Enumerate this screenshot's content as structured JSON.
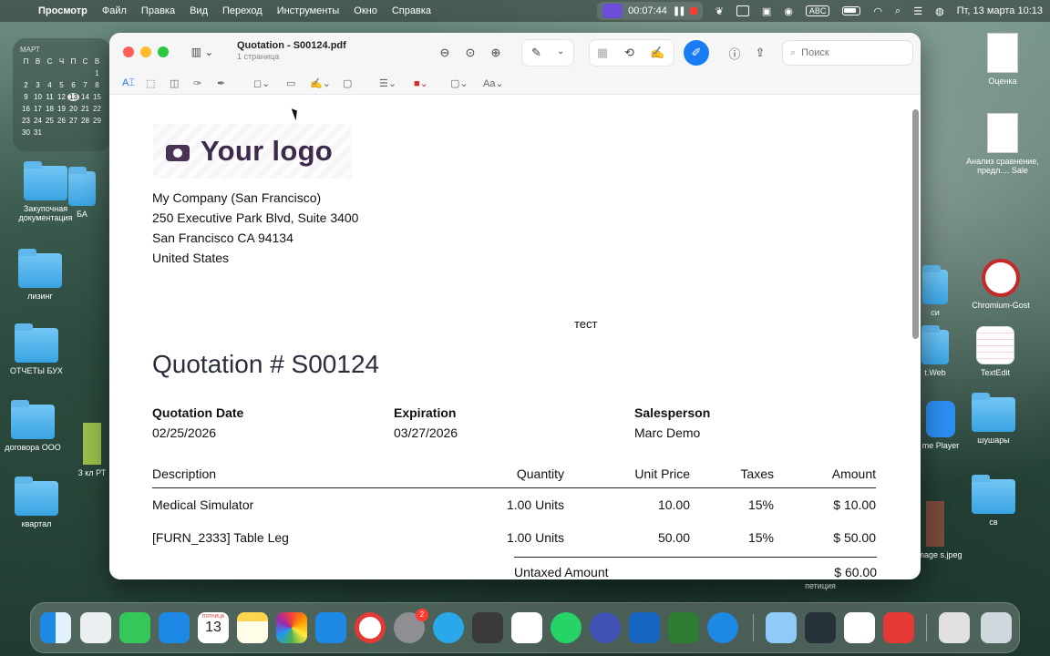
{
  "menubar": {
    "app_name": "Просмотр",
    "items": [
      "Файл",
      "Правка",
      "Вид",
      "Переход",
      "Инструменты",
      "Окно",
      "Справка"
    ],
    "timer": "00:07:44",
    "keyboard": "ABC",
    "datetime": "Пт, 13 марта  10:13"
  },
  "calendar_widget": {
    "month": "МАРТ",
    "weekdays": [
      "П",
      "В",
      "С",
      "Ч",
      "П",
      "С",
      "В"
    ],
    "days": [
      "",
      "",
      "",
      "",
      "",
      "",
      "1",
      "2",
      "3",
      "4",
      "5",
      "6",
      "7",
      "8",
      "9",
      "10",
      "11",
      "12",
      "13",
      "14",
      "15",
      "16",
      "17",
      "18",
      "19",
      "20",
      "21",
      "22",
      "23",
      "24",
      "25",
      "26",
      "27",
      "28",
      "29",
      "30",
      "31"
    ],
    "today": "13"
  },
  "desktop": {
    "left_icons": [
      "Закупочная документация",
      "БА",
      "лизинг",
      "ОТЧЕТЫ БУХ",
      "договора ООО",
      "3 кл РТ",
      "квартал"
    ],
    "right_icons": [
      "Оценка",
      "Анализ сравнение, предл.... Sale",
      "Chromium-Gost",
      "си",
      "TextEdit",
      "t.Web",
      "шушары",
      "me Player",
      "св",
      "n Image s.jpeg",
      "петиция"
    ]
  },
  "window": {
    "title": "Quotation - S00124.pdf",
    "subtitle": "1 страница",
    "search_placeholder": "Поиск"
  },
  "doc": {
    "logo_text": "Your logo",
    "address": [
      "My Company (San Francisco)",
      "250 Executive Park Blvd, Suite 3400",
      "San Francisco CA 94134",
      "United States"
    ],
    "annotation": "тест",
    "title": "Quotation # S00124",
    "meta": [
      {
        "label": "Quotation Date",
        "value": "02/25/2026"
      },
      {
        "label": "Expiration",
        "value": "03/27/2026"
      },
      {
        "label": "Salesperson",
        "value": "Marc Demo"
      }
    ],
    "headers": {
      "description": "Description",
      "quantity": "Quantity",
      "unit_price": "Unit Price",
      "taxes": "Taxes",
      "amount": "Amount"
    },
    "lines": [
      {
        "description": "Medical Simulator",
        "quantity": "1.00 Units",
        "unit_price": "10.00",
        "taxes": "15%",
        "amount": "$ 10.00"
      },
      {
        "description": "[FURN_2333] Table Leg",
        "quantity": "1.00 Units",
        "unit_price": "50.00",
        "taxes": "15%",
        "amount": "$ 50.00"
      }
    ],
    "untaxed_label": "Untaxed Amount",
    "untaxed_value": "$ 60.00"
  },
  "dock": {
    "calendar_month": "ПЯТНИЦА",
    "calendar_day": "13",
    "settings_badge": "2",
    "apps": [
      "finder-icon",
      "launchpad-icon",
      "messages-icon",
      "mail-icon",
      "calendar-icon",
      "notes-icon",
      "photos-icon",
      "app-store-icon",
      "opera-icon",
      "system-settings-icon",
      "telegram-icon",
      "calculator-icon",
      "freeform-icon",
      "whatsapp-icon",
      "yandex-icon",
      "word-icon",
      "excel-icon",
      "safari-icon",
      "vpn-icon",
      "screen-recorder-icon",
      "textedit-icon",
      "zoom-icon",
      "trash-icon"
    ]
  }
}
